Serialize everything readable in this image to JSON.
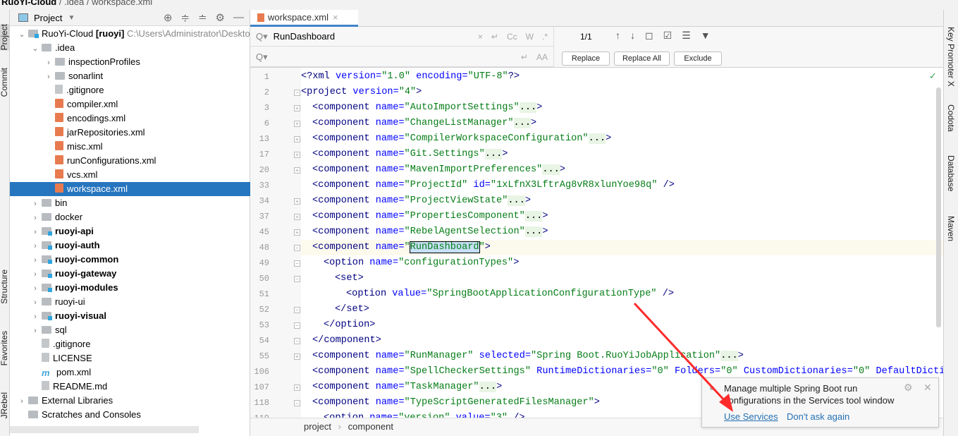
{
  "breadcrumb_top": [
    "RuoYi-Cloud",
    ".idea",
    "workspace.xml"
  ],
  "left_strip": [
    "Project",
    "Commit",
    "Structure",
    "Favorites",
    "JRebel"
  ],
  "right_strip": [
    "Key Promoter X",
    "Codota",
    "Database",
    "Maven"
  ],
  "project_panel": {
    "title": "Project",
    "tree": [
      {
        "label": "RuoYi-Cloud",
        "bold_suffix": "[ruoyi]",
        "hint": "C:\\Users\\Administrator\\Deskto",
        "depth": 0,
        "arrow": "open",
        "icon": "module-folder"
      },
      {
        "label": ".idea",
        "depth": 1,
        "arrow": "open",
        "icon": "folder"
      },
      {
        "label": "inspectionProfiles",
        "depth": 2,
        "arrow": "closed",
        "icon": "folder"
      },
      {
        "label": "sonarlint",
        "depth": 2,
        "arrow": "closed",
        "icon": "folder"
      },
      {
        "label": ".gitignore",
        "depth": 2,
        "icon": "file"
      },
      {
        "label": "compiler.xml",
        "depth": 2,
        "icon": "xml"
      },
      {
        "label": "encodings.xml",
        "depth": 2,
        "icon": "xml"
      },
      {
        "label": "jarRepositories.xml",
        "depth": 2,
        "icon": "xml"
      },
      {
        "label": "misc.xml",
        "depth": 2,
        "icon": "xml"
      },
      {
        "label": "runConfigurations.xml",
        "depth": 2,
        "icon": "xml"
      },
      {
        "label": "vcs.xml",
        "depth": 2,
        "icon": "xml"
      },
      {
        "label": "workspace.xml",
        "depth": 2,
        "icon": "xml",
        "selected": true
      },
      {
        "label": "bin",
        "depth": 1,
        "arrow": "closed",
        "icon": "folder"
      },
      {
        "label": "docker",
        "depth": 1,
        "arrow": "closed",
        "icon": "folder"
      },
      {
        "label": "ruoyi-api",
        "depth": 1,
        "arrow": "closed",
        "icon": "module-folder",
        "bold": true
      },
      {
        "label": "ruoyi-auth",
        "depth": 1,
        "arrow": "closed",
        "icon": "module-folder",
        "bold": true
      },
      {
        "label": "ruoyi-common",
        "depth": 1,
        "arrow": "closed",
        "icon": "module-folder",
        "bold": true
      },
      {
        "label": "ruoyi-gateway",
        "depth": 1,
        "arrow": "closed",
        "icon": "module-folder",
        "bold": true
      },
      {
        "label": "ruoyi-modules",
        "depth": 1,
        "arrow": "closed",
        "icon": "module-folder",
        "bold": true
      },
      {
        "label": "ruoyi-ui",
        "depth": 1,
        "arrow": "closed",
        "icon": "folder"
      },
      {
        "label": "ruoyi-visual",
        "depth": 1,
        "arrow": "closed",
        "icon": "module-folder",
        "bold": true
      },
      {
        "label": "sql",
        "depth": 1,
        "arrow": "closed",
        "icon": "folder"
      },
      {
        "label": ".gitignore",
        "depth": 1,
        "icon": "file"
      },
      {
        "label": "LICENSE",
        "depth": 1,
        "icon": "file"
      },
      {
        "label": "pom.xml",
        "depth": 1,
        "icon": "maven"
      },
      {
        "label": "README.md",
        "depth": 1,
        "icon": "file"
      },
      {
        "label": "External Libraries",
        "depth": 0,
        "arrow": "closed",
        "icon": "library"
      },
      {
        "label": "Scratches and Consoles",
        "depth": 0,
        "icon": "scratch"
      }
    ]
  },
  "editor": {
    "tab": "workspace.xml",
    "find": {
      "query": "RunDashboard",
      "replace_placeholder": "",
      "count": "1/1",
      "options": [
        "Cc",
        "W",
        ".*"
      ]
    },
    "buttons": {
      "replace": "Replace",
      "replace_all": "Replace All",
      "exclude": "Exclude"
    },
    "lines": [
      {
        "n": "1",
        "i": 0,
        "parts": [
          [
            "t",
            "<?xml "
          ],
          [
            "a",
            "version="
          ],
          [
            "v",
            "\"1.0\""
          ],
          [
            "a",
            " encoding="
          ],
          [
            "v",
            "\"UTF-8\""
          ],
          [
            "t",
            "?>"
          ]
        ]
      },
      {
        "n": "2",
        "i": 0,
        "fold": "-",
        "parts": [
          [
            "t",
            "<project "
          ],
          [
            "a",
            "version="
          ],
          [
            "v",
            "\"4\""
          ],
          [
            "t",
            ">"
          ]
        ]
      },
      {
        "n": "3",
        "i": 1,
        "fold": "+",
        "parts": [
          [
            "t",
            "<component "
          ],
          [
            "a",
            "name="
          ],
          [
            "v",
            "\"AutoImportSettings\""
          ],
          [
            "f",
            "..."
          ],
          [
            "t",
            ">"
          ]
        ]
      },
      {
        "n": "6",
        "i": 1,
        "fold": "+",
        "parts": [
          [
            "t",
            "<component "
          ],
          [
            "a",
            "name="
          ],
          [
            "v",
            "\"ChangeListManager\""
          ],
          [
            "f",
            "..."
          ],
          [
            "t",
            ">"
          ]
        ]
      },
      {
        "n": "13",
        "i": 1,
        "fold": "+",
        "parts": [
          [
            "t",
            "<component "
          ],
          [
            "a",
            "name="
          ],
          [
            "v",
            "\"CompilerWorkspaceConfiguration\""
          ],
          [
            "f",
            "..."
          ],
          [
            "t",
            ">"
          ]
        ]
      },
      {
        "n": "17",
        "i": 1,
        "fold": "+",
        "parts": [
          [
            "t",
            "<component "
          ],
          [
            "a",
            "name="
          ],
          [
            "v",
            "\"Git.Settings\""
          ],
          [
            "f",
            "..."
          ],
          [
            "t",
            ">"
          ]
        ]
      },
      {
        "n": "20",
        "i": 1,
        "fold": "+",
        "parts": [
          [
            "t",
            "<component "
          ],
          [
            "a",
            "name="
          ],
          [
            "v",
            "\"MavenImportPreferences\""
          ],
          [
            "f",
            "..."
          ],
          [
            "t",
            ">"
          ]
        ]
      },
      {
        "n": "33",
        "i": 1,
        "parts": [
          [
            "t",
            "<component "
          ],
          [
            "a",
            "name="
          ],
          [
            "v",
            "\"ProjectId\""
          ],
          [
            "a",
            " id="
          ],
          [
            "v",
            "\"1xLfnX3LftrAg8vR8xlunYoe98q\""
          ],
          [
            "t",
            " />"
          ]
        ]
      },
      {
        "n": "34",
        "i": 1,
        "fold": "+",
        "parts": [
          [
            "t",
            "<component "
          ],
          [
            "a",
            "name="
          ],
          [
            "v",
            "\"ProjectViewState\""
          ],
          [
            "f",
            "..."
          ],
          [
            "t",
            ">"
          ]
        ]
      },
      {
        "n": "37",
        "i": 1,
        "fold": "+",
        "parts": [
          [
            "t",
            "<component "
          ],
          [
            "a",
            "name="
          ],
          [
            "v",
            "\"PropertiesComponent\""
          ],
          [
            "f",
            "..."
          ],
          [
            "t",
            ">"
          ]
        ]
      },
      {
        "n": "45",
        "i": 1,
        "fold": "+",
        "parts": [
          [
            "t",
            "<component "
          ],
          [
            "a",
            "name="
          ],
          [
            "v",
            "\"RebelAgentSelection\""
          ],
          [
            "f",
            "..."
          ],
          [
            "t",
            ">"
          ]
        ]
      },
      {
        "n": "48",
        "i": 1,
        "fold": "-",
        "cur": true,
        "parts": [
          [
            "t",
            "<component "
          ],
          [
            "a",
            "name="
          ],
          [
            "v",
            "\""
          ],
          [
            "h",
            "RunDashboard"
          ],
          [
            "v",
            "\""
          ],
          [
            "t",
            ">"
          ]
        ]
      },
      {
        "n": "49",
        "i": 2,
        "fold": "-",
        "parts": [
          [
            "t",
            "<option "
          ],
          [
            "a",
            "name="
          ],
          [
            "v",
            "\"configurationTypes\""
          ],
          [
            "t",
            ">"
          ]
        ]
      },
      {
        "n": "50",
        "i": 3,
        "fold": "-",
        "parts": [
          [
            "t",
            "<set>"
          ]
        ]
      },
      {
        "n": "51",
        "i": 4,
        "parts": [
          [
            "t",
            "<option "
          ],
          [
            "a",
            "value="
          ],
          [
            "v",
            "\"SpringBootApplicationConfigurationType\""
          ],
          [
            "t",
            " />"
          ]
        ]
      },
      {
        "n": "52",
        "i": 3,
        "fold": "-",
        "parts": [
          [
            "t",
            "</set>"
          ]
        ]
      },
      {
        "n": "53",
        "i": 2,
        "fold": "-",
        "parts": [
          [
            "t",
            "</option>"
          ]
        ]
      },
      {
        "n": "54",
        "i": 1,
        "fold": "-",
        "parts": [
          [
            "t",
            "</component>"
          ]
        ]
      },
      {
        "n": "55",
        "i": 1,
        "fold": "+",
        "parts": [
          [
            "t",
            "<component "
          ],
          [
            "a",
            "name="
          ],
          [
            "v",
            "\"RunManager\""
          ],
          [
            "a",
            " selected="
          ],
          [
            "v",
            "\"Spring Boot.RuoYiJobApplication\""
          ],
          [
            "f",
            "..."
          ],
          [
            "t",
            ">"
          ]
        ]
      },
      {
        "n": "106",
        "i": 1,
        "parts": [
          [
            "t",
            "<component "
          ],
          [
            "a",
            "name="
          ],
          [
            "v",
            "\"SpellCheckerSettings\""
          ],
          [
            "a",
            " RuntimeDictionaries="
          ],
          [
            "v",
            "\"0\""
          ],
          [
            "a",
            " Folders="
          ],
          [
            "v",
            "\"0\""
          ],
          [
            "a",
            " CustomDictionaries="
          ],
          [
            "v",
            "\"0\""
          ],
          [
            "a",
            " DefaultDiction"
          ]
        ]
      },
      {
        "n": "107",
        "i": 1,
        "fold": "+",
        "parts": [
          [
            "t",
            "<component "
          ],
          [
            "a",
            "name="
          ],
          [
            "v",
            "\"TaskManager\""
          ],
          [
            "f",
            "..."
          ],
          [
            "t",
            ">"
          ]
        ]
      },
      {
        "n": "118",
        "i": 1,
        "fold": "-",
        "parts": [
          [
            "t",
            "<component "
          ],
          [
            "a",
            "name="
          ],
          [
            "v",
            "\"TypeScriptGeneratedFilesManager\""
          ],
          [
            "t",
            ">"
          ]
        ]
      },
      {
        "n": "119",
        "i": 2,
        "parts": [
          [
            "t",
            "<option "
          ],
          [
            "a",
            "name="
          ],
          [
            "v",
            "\"version\""
          ],
          [
            "a",
            " value="
          ],
          [
            "v",
            "\"3\""
          ],
          [
            "t",
            " />"
          ]
        ]
      }
    ],
    "breadcrumb": [
      "project",
      "component"
    ]
  },
  "notification": {
    "message": "Manage multiple Spring Boot run configurations in the Services tool window",
    "actions": [
      "Use Services",
      "Don't ask again"
    ]
  },
  "colors": {
    "selection": "#2675bf",
    "tag": "#000080",
    "attr": "#0000ff",
    "value": "#067d17",
    "annotation_arrow": "#ff2a2a"
  }
}
